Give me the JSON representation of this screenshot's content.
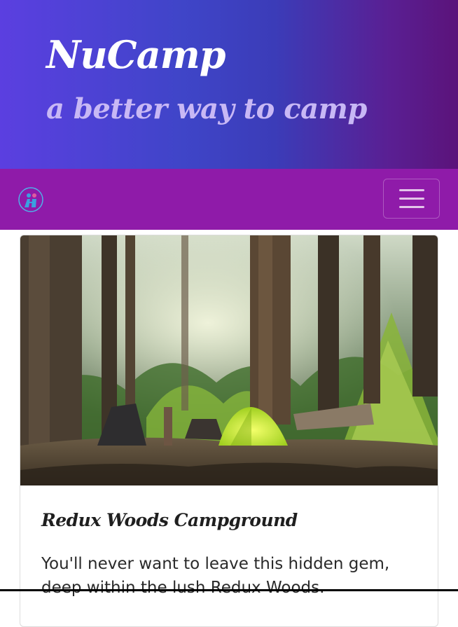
{
  "header": {
    "title": "NuCamp",
    "subtitle": "a better way to camp"
  },
  "navbar": {
    "logo_icon": "nucamp-logo-icon",
    "toggler_icon": "hamburger-menu-icon",
    "colors": {
      "background": "#8f1ba9"
    }
  },
  "card": {
    "image_alt": "campsite with tent in forest",
    "title": "Redux Woods Campground",
    "text": "You'll never want to leave this hidden gem, deep within the lush Redux Woods."
  },
  "colors": {
    "header_gradient_start": "#5b3fe0",
    "header_gradient_end": "#5b137a",
    "subtitle": "#c8b8f5"
  }
}
